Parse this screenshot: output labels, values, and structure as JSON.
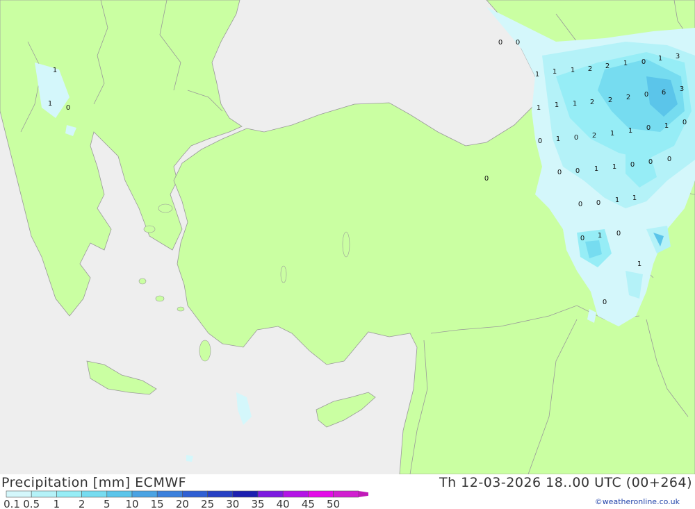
{
  "legend": {
    "title": "Precipitation [mm] ECMWF",
    "valid_time": "Th 12-03-2026 18..00 UTC (00+264)",
    "credit": "©weatheronline.co.uk",
    "scale_labels": [
      "0.1",
      "0.5",
      "1",
      "2",
      "5",
      "10",
      "15",
      "20",
      "25",
      "30",
      "35",
      "40",
      "45",
      "50"
    ],
    "scale_colors": [
      "#d4f7fb",
      "#b4f2f8",
      "#96edf6",
      "#76dcf0",
      "#5bc5ea",
      "#4aa3e3",
      "#3b80dc",
      "#2f5fd3",
      "#2741c4",
      "#1c1fb0",
      "#7d1be0",
      "#b414e6",
      "#e40ce8",
      "#d11fd0"
    ]
  },
  "colors": {
    "land": "#caff a2",
    "sea": "#eeeeee",
    "border": "#999999"
  },
  "map_values": {
    "labels": [
      "0",
      "0",
      "1",
      "1",
      "0",
      "1",
      "1",
      "1",
      "2",
      "2",
      "1",
      "0",
      "1",
      "3",
      "6",
      "3",
      "1",
      "1",
      "1",
      "2",
      "2",
      "2",
      "0",
      "0",
      "1",
      "0",
      "2",
      "1",
      "1",
      "0",
      "1",
      "0",
      "0",
      "0",
      "1",
      "1",
      "0",
      "0",
      "0",
      "0",
      "0",
      "1",
      "1",
      "0",
      "1",
      "0",
      "1",
      "0",
      "0"
    ]
  }
}
